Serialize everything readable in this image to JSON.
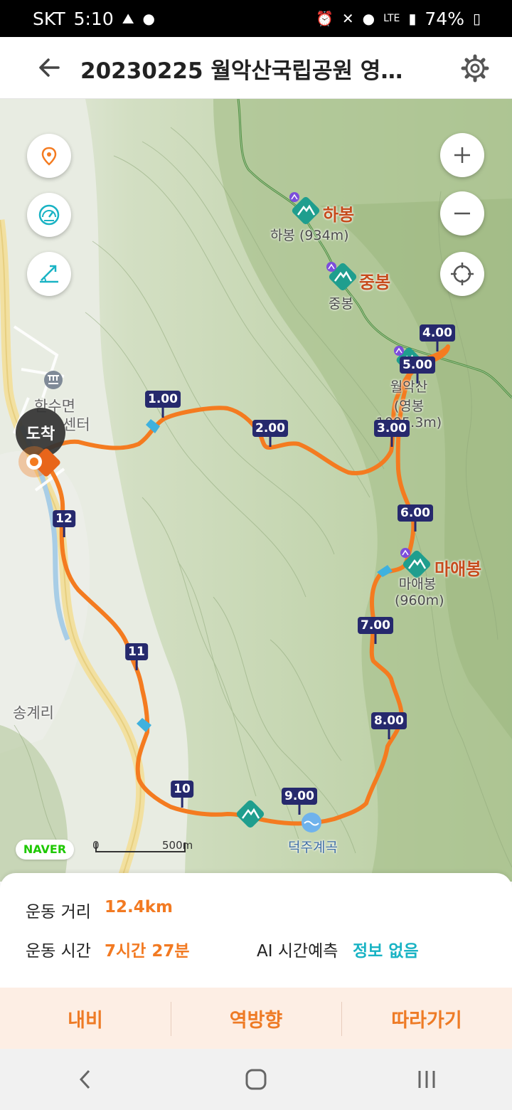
{
  "status_bar": {
    "carrier": "SKT",
    "time": "5:10",
    "network": "LTE",
    "battery": "74%"
  },
  "header": {
    "title": "20230225 월악산국립공원 영봉..."
  },
  "map": {
    "peaks": [
      {
        "name": "하봉",
        "sub": "하봉 (934m)"
      },
      {
        "name": "중봉",
        "sub": "중봉"
      },
      {
        "name": "월악산",
        "sub": "월악산\n(영봉1095.3m)"
      },
      {
        "name": "마애봉",
        "sub": "마애봉\n(960m)"
      }
    ],
    "km_markers": [
      "1.00",
      "2.00",
      "3.00",
      "4.00",
      "5.00",
      "6.00",
      "7.00",
      "8.00",
      "9.00",
      "10",
      "11",
      "12"
    ],
    "places": {
      "songgye": "송계리",
      "myeon": "한수면",
      "center": "센터",
      "valley": "덕주계곡"
    },
    "arrive_label": "도착",
    "naver": "NAVER",
    "scale_zero": "0",
    "scale_distance": "500m",
    "route_color": "#f47b20"
  },
  "info": {
    "distance_label": "운동 거리",
    "distance_value": "12.4km",
    "time_label": "운동 시간",
    "time_value": "7시간 27분",
    "ai_label": "AI 시간예측",
    "ai_value": "정보 없음"
  },
  "actions": {
    "navi": "내비",
    "reverse": "역방향",
    "follow": "따라가기"
  }
}
